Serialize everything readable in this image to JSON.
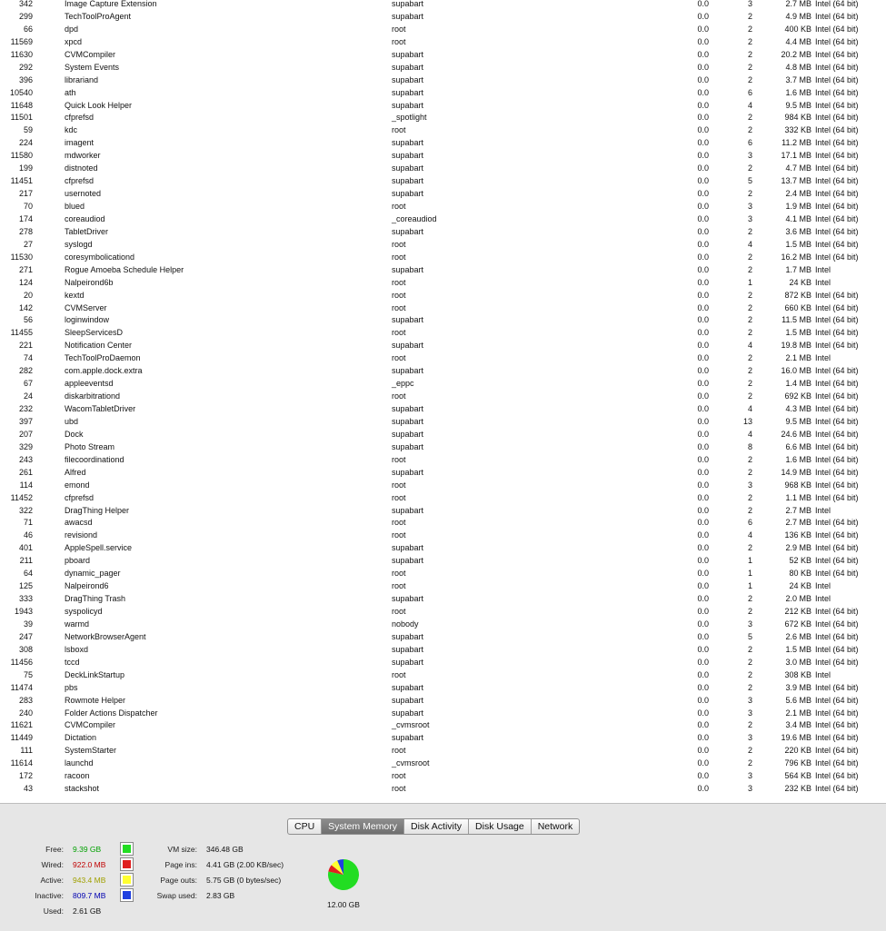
{
  "processes": [
    {
      "pid": "342",
      "name": "Image Capture Extension",
      "user": "supabart",
      "cpu": "0.0",
      "threads": "3",
      "mem": "2.7 MB",
      "kind": "Intel (64 bit)"
    },
    {
      "pid": "299",
      "name": "TechToolProAgent",
      "user": "supabart",
      "cpu": "0.0",
      "threads": "2",
      "mem": "4.9 MB",
      "kind": "Intel (64 bit)"
    },
    {
      "pid": "66",
      "name": "dpd",
      "user": "root",
      "cpu": "0.0",
      "threads": "2",
      "mem": "400 KB",
      "kind": "Intel (64 bit)"
    },
    {
      "pid": "11569",
      "name": "xpcd",
      "user": "root",
      "cpu": "0.0",
      "threads": "2",
      "mem": "4.4 MB",
      "kind": "Intel (64 bit)"
    },
    {
      "pid": "11630",
      "name": "CVMCompiler",
      "user": "supabart",
      "cpu": "0.0",
      "threads": "2",
      "mem": "20.2 MB",
      "kind": "Intel (64 bit)"
    },
    {
      "pid": "292",
      "name": "System Events",
      "user": "supabart",
      "cpu": "0.0",
      "threads": "2",
      "mem": "4.8 MB",
      "kind": "Intel (64 bit)"
    },
    {
      "pid": "396",
      "name": "librariand",
      "user": "supabart",
      "cpu": "0.0",
      "threads": "2",
      "mem": "3.7 MB",
      "kind": "Intel (64 bit)"
    },
    {
      "pid": "10540",
      "name": "ath",
      "user": "supabart",
      "cpu": "0.0",
      "threads": "6",
      "mem": "1.6 MB",
      "kind": "Intel (64 bit)"
    },
    {
      "pid": "11648",
      "name": "Quick Look Helper",
      "user": "supabart",
      "cpu": "0.0",
      "threads": "4",
      "mem": "9.5 MB",
      "kind": "Intel (64 bit)"
    },
    {
      "pid": "11501",
      "name": "cfprefsd",
      "user": "_spotlight",
      "cpu": "0.0",
      "threads": "2",
      "mem": "984 KB",
      "kind": "Intel (64 bit)"
    },
    {
      "pid": "59",
      "name": "kdc",
      "user": "root",
      "cpu": "0.0",
      "threads": "2",
      "mem": "332 KB",
      "kind": "Intel (64 bit)"
    },
    {
      "pid": "224",
      "name": "imagent",
      "user": "supabart",
      "cpu": "0.0",
      "threads": "6",
      "mem": "11.2 MB",
      "kind": "Intel (64 bit)"
    },
    {
      "pid": "11580",
      "name": "mdworker",
      "user": "supabart",
      "cpu": "0.0",
      "threads": "3",
      "mem": "17.1 MB",
      "kind": "Intel (64 bit)"
    },
    {
      "pid": "199",
      "name": "distnoted",
      "user": "supabart",
      "cpu": "0.0",
      "threads": "2",
      "mem": "4.7 MB",
      "kind": "Intel (64 bit)"
    },
    {
      "pid": "11451",
      "name": "cfprefsd",
      "user": "supabart",
      "cpu": "0.0",
      "threads": "5",
      "mem": "13.7 MB",
      "kind": "Intel (64 bit)"
    },
    {
      "pid": "217",
      "name": "usernoted",
      "user": "supabart",
      "cpu": "0.0",
      "threads": "2",
      "mem": "2.4 MB",
      "kind": "Intel (64 bit)"
    },
    {
      "pid": "70",
      "name": "blued",
      "user": "root",
      "cpu": "0.0",
      "threads": "3",
      "mem": "1.9 MB",
      "kind": "Intel (64 bit)"
    },
    {
      "pid": "174",
      "name": "coreaudiod",
      "user": "_coreaudiod",
      "cpu": "0.0",
      "threads": "3",
      "mem": "4.1 MB",
      "kind": "Intel (64 bit)"
    },
    {
      "pid": "278",
      "name": "TabletDriver",
      "user": "supabart",
      "cpu": "0.0",
      "threads": "2",
      "mem": "3.6 MB",
      "kind": "Intel (64 bit)"
    },
    {
      "pid": "27",
      "name": "syslogd",
      "user": "root",
      "cpu": "0.0",
      "threads": "4",
      "mem": "1.5 MB",
      "kind": "Intel (64 bit)"
    },
    {
      "pid": "11530",
      "name": "coresymbolicationd",
      "user": "root",
      "cpu": "0.0",
      "threads": "2",
      "mem": "16.2 MB",
      "kind": "Intel (64 bit)"
    },
    {
      "pid": "271",
      "name": "Rogue Amoeba Schedule Helper",
      "user": "supabart",
      "cpu": "0.0",
      "threads": "2",
      "mem": "1.7 MB",
      "kind": "Intel"
    },
    {
      "pid": "124",
      "name": "Nalpeirond6b",
      "user": "root",
      "cpu": "0.0",
      "threads": "1",
      "mem": "24 KB",
      "kind": "Intel"
    },
    {
      "pid": "20",
      "name": "kextd",
      "user": "root",
      "cpu": "0.0",
      "threads": "2",
      "mem": "872 KB",
      "kind": "Intel (64 bit)"
    },
    {
      "pid": "142",
      "name": "CVMServer",
      "user": "root",
      "cpu": "0.0",
      "threads": "2",
      "mem": "660 KB",
      "kind": "Intel (64 bit)"
    },
    {
      "pid": "56",
      "name": "loginwindow",
      "user": "supabart",
      "cpu": "0.0",
      "threads": "2",
      "mem": "11.5 MB",
      "kind": "Intel (64 bit)"
    },
    {
      "pid": "11455",
      "name": "SleepServicesD",
      "user": "root",
      "cpu": "0.0",
      "threads": "2",
      "mem": "1.5 MB",
      "kind": "Intel (64 bit)"
    },
    {
      "pid": "221",
      "name": "Notification Center",
      "user": "supabart",
      "cpu": "0.0",
      "threads": "4",
      "mem": "19.8 MB",
      "kind": "Intel (64 bit)"
    },
    {
      "pid": "74",
      "name": "TechToolProDaemon",
      "user": "root",
      "cpu": "0.0",
      "threads": "2",
      "mem": "2.1 MB",
      "kind": "Intel"
    },
    {
      "pid": "282",
      "name": "com.apple.dock.extra",
      "user": "supabart",
      "cpu": "0.0",
      "threads": "2",
      "mem": "16.0 MB",
      "kind": "Intel (64 bit)"
    },
    {
      "pid": "67",
      "name": "appleeventsd",
      "user": "_eppc",
      "cpu": "0.0",
      "threads": "2",
      "mem": "1.4 MB",
      "kind": "Intel (64 bit)"
    },
    {
      "pid": "24",
      "name": "diskarbitrationd",
      "user": "root",
      "cpu": "0.0",
      "threads": "2",
      "mem": "692 KB",
      "kind": "Intel (64 bit)"
    },
    {
      "pid": "232",
      "name": "WacomTabletDriver",
      "user": "supabart",
      "cpu": "0.0",
      "threads": "4",
      "mem": "4.3 MB",
      "kind": "Intel (64 bit)"
    },
    {
      "pid": "397",
      "name": "ubd",
      "user": "supabart",
      "cpu": "0.0",
      "threads": "13",
      "mem": "9.5 MB",
      "kind": "Intel (64 bit)"
    },
    {
      "pid": "207",
      "name": "Dock",
      "user": "supabart",
      "cpu": "0.0",
      "threads": "4",
      "mem": "24.6 MB",
      "kind": "Intel (64 bit)"
    },
    {
      "pid": "329",
      "name": "Photo Stream",
      "user": "supabart",
      "cpu": "0.0",
      "threads": "8",
      "mem": "6.6 MB",
      "kind": "Intel (64 bit)"
    },
    {
      "pid": "243",
      "name": "filecoordinationd",
      "user": "root",
      "cpu": "0.0",
      "threads": "2",
      "mem": "1.6 MB",
      "kind": "Intel (64 bit)"
    },
    {
      "pid": "261",
      "name": "Alfred",
      "user": "supabart",
      "cpu": "0.0",
      "threads": "2",
      "mem": "14.9 MB",
      "kind": "Intel (64 bit)"
    },
    {
      "pid": "114",
      "name": "emond",
      "user": "root",
      "cpu": "0.0",
      "threads": "3",
      "mem": "968 KB",
      "kind": "Intel (64 bit)"
    },
    {
      "pid": "11452",
      "name": "cfprefsd",
      "user": "root",
      "cpu": "0.0",
      "threads": "2",
      "mem": "1.1 MB",
      "kind": "Intel (64 bit)"
    },
    {
      "pid": "322",
      "name": "DragThing Helper",
      "user": "supabart",
      "cpu": "0.0",
      "threads": "2",
      "mem": "2.7 MB",
      "kind": "Intel"
    },
    {
      "pid": "71",
      "name": "awacsd",
      "user": "root",
      "cpu": "0.0",
      "threads": "6",
      "mem": "2.7 MB",
      "kind": "Intel (64 bit)"
    },
    {
      "pid": "46",
      "name": "revisiond",
      "user": "root",
      "cpu": "0.0",
      "threads": "4",
      "mem": "136 KB",
      "kind": "Intel (64 bit)"
    },
    {
      "pid": "401",
      "name": "AppleSpell.service",
      "user": "supabart",
      "cpu": "0.0",
      "threads": "2",
      "mem": "2.9 MB",
      "kind": "Intel (64 bit)"
    },
    {
      "pid": "211",
      "name": "pboard",
      "user": "supabart",
      "cpu": "0.0",
      "threads": "1",
      "mem": "52 KB",
      "kind": "Intel (64 bit)"
    },
    {
      "pid": "64",
      "name": "dynamic_pager",
      "user": "root",
      "cpu": "0.0",
      "threads": "1",
      "mem": "80 KB",
      "kind": "Intel (64 bit)"
    },
    {
      "pid": "125",
      "name": "Nalpeirond6",
      "user": "root",
      "cpu": "0.0",
      "threads": "1",
      "mem": "24 KB",
      "kind": "Intel"
    },
    {
      "pid": "333",
      "name": "DragThing Trash",
      "user": "supabart",
      "cpu": "0.0",
      "threads": "2",
      "mem": "2.0 MB",
      "kind": "Intel"
    },
    {
      "pid": "1943",
      "name": "syspolicyd",
      "user": "root",
      "cpu": "0.0",
      "threads": "2",
      "mem": "212 KB",
      "kind": "Intel (64 bit)"
    },
    {
      "pid": "39",
      "name": "warmd",
      "user": "nobody",
      "cpu": "0.0",
      "threads": "3",
      "mem": "672 KB",
      "kind": "Intel (64 bit)"
    },
    {
      "pid": "247",
      "name": "NetworkBrowserAgent",
      "user": "supabart",
      "cpu": "0.0",
      "threads": "5",
      "mem": "2.6 MB",
      "kind": "Intel (64 bit)"
    },
    {
      "pid": "308",
      "name": "lsboxd",
      "user": "supabart",
      "cpu": "0.0",
      "threads": "2",
      "mem": "1.5 MB",
      "kind": "Intel (64 bit)"
    },
    {
      "pid": "11456",
      "name": "tccd",
      "user": "supabart",
      "cpu": "0.0",
      "threads": "2",
      "mem": "3.0 MB",
      "kind": "Intel (64 bit)"
    },
    {
      "pid": "75",
      "name": "DeckLinkStartup",
      "user": "root",
      "cpu": "0.0",
      "threads": "2",
      "mem": "308 KB",
      "kind": "Intel"
    },
    {
      "pid": "11474",
      "name": "pbs",
      "user": "supabart",
      "cpu": "0.0",
      "threads": "2",
      "mem": "3.9 MB",
      "kind": "Intel (64 bit)"
    },
    {
      "pid": "283",
      "name": "Rowmote Helper",
      "user": "supabart",
      "cpu": "0.0",
      "threads": "3",
      "mem": "5.6 MB",
      "kind": "Intel (64 bit)"
    },
    {
      "pid": "240",
      "name": "Folder Actions Dispatcher",
      "user": "supabart",
      "cpu": "0.0",
      "threads": "3",
      "mem": "2.1 MB",
      "kind": "Intel (64 bit)"
    },
    {
      "pid": "11621",
      "name": "CVMCompiler",
      "user": "_cvmsroot",
      "cpu": "0.0",
      "threads": "2",
      "mem": "3.4 MB",
      "kind": "Intel (64 bit)"
    },
    {
      "pid": "11449",
      "name": "Dictation",
      "user": "supabart",
      "cpu": "0.0",
      "threads": "3",
      "mem": "19.6 MB",
      "kind": "Intel (64 bit)"
    },
    {
      "pid": "111",
      "name": "SystemStarter",
      "user": "root",
      "cpu": "0.0",
      "threads": "2",
      "mem": "220 KB",
      "kind": "Intel (64 bit)"
    },
    {
      "pid": "11614",
      "name": "launchd",
      "user": "_cvmsroot",
      "cpu": "0.0",
      "threads": "2",
      "mem": "796 KB",
      "kind": "Intel (64 bit)"
    },
    {
      "pid": "172",
      "name": "racoon",
      "user": "root",
      "cpu": "0.0",
      "threads": "3",
      "mem": "564 KB",
      "kind": "Intel (64 bit)"
    },
    {
      "pid": "43",
      "name": "stackshot",
      "user": "root",
      "cpu": "0.0",
      "threads": "3",
      "mem": "232 KB",
      "kind": "Intel (64 bit)"
    }
  ],
  "tabs": [
    {
      "id": "cpu",
      "label": "CPU",
      "active": false
    },
    {
      "id": "system-memory",
      "label": "System Memory",
      "active": true
    },
    {
      "id": "disk-activity",
      "label": "Disk Activity",
      "active": false
    },
    {
      "id": "disk-usage",
      "label": "Disk Usage",
      "active": false
    },
    {
      "id": "network",
      "label": "Network",
      "active": false
    }
  ],
  "memory": {
    "free": {
      "label": "Free:",
      "value": "9.39 GB",
      "color": "#00a000",
      "swatch": "#22dd22"
    },
    "wired": {
      "label": "Wired:",
      "value": "922.0 MB",
      "color": "#c00000",
      "swatch": "#e02020"
    },
    "active": {
      "label": "Active:",
      "value": "943.4 MB",
      "color": "#a0a000",
      "swatch": "#ffff30"
    },
    "inactive": {
      "label": "Inactive:",
      "value": "809.7 MB",
      "color": "#0000b0",
      "swatch": "#2040e0"
    },
    "used": {
      "label": "Used:",
      "value": "2.61 GB"
    }
  },
  "vm": {
    "vm_size": {
      "label": "VM size:",
      "value": "346.48 GB"
    },
    "page_ins": {
      "label": "Page ins:",
      "value": "4.41 GB (2.00 KB/sec)"
    },
    "page_outs": {
      "label": "Page outs:",
      "value": "5.75 GB (0 bytes/sec)"
    },
    "swap_used": {
      "label": "Swap used:",
      "value": "2.83 GB"
    }
  },
  "pie": {
    "total": "12.00 GB",
    "slices": [
      {
        "name": "Free",
        "gb": 9.39,
        "color": "#22dd22"
      },
      {
        "name": "Wired",
        "gb": 0.9,
        "color": "#e02020"
      },
      {
        "name": "Active",
        "gb": 0.92,
        "color": "#ffff30"
      },
      {
        "name": "Inactive",
        "gb": 0.79,
        "color": "#2040e0"
      }
    ]
  }
}
